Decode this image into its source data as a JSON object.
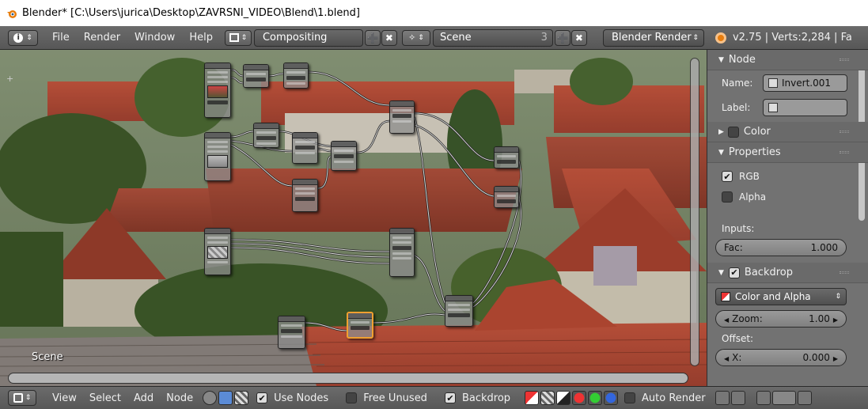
{
  "window": {
    "title": "Blender* [C:\\Users\\jurica\\Desktop\\ZAVRSNI_VIDEO\\Blend\\1.blend]"
  },
  "top_header": {
    "menus": [
      "File",
      "Render",
      "Window",
      "Help"
    ],
    "screen_layout": "Compositing",
    "scene": "Scene",
    "scene_users": "3",
    "render_engine": "Blender Render",
    "version_stats": "v2.75 | Verts:2,284 | Fa"
  },
  "editor": {
    "scene_label": "Scene",
    "plus": "+"
  },
  "properties_panel": {
    "node_section": {
      "header": "Node",
      "name_label": "Name:",
      "name_value": "Invert.001",
      "label_label": "Label:",
      "label_value": ""
    },
    "color_section": {
      "header": "Color"
    },
    "properties_section": {
      "header": "Properties",
      "rgb_label": "RGB",
      "rgb_checked": true,
      "alpha_label": "Alpha",
      "alpha_checked": false,
      "inputs_label": "Inputs:",
      "fac_label": "Fac:",
      "fac_value": "1.000"
    },
    "backdrop_section": {
      "header": "Backdrop",
      "channels": "Color and Alpha",
      "zoom_label": "Zoom:",
      "zoom_value": "1.00",
      "offset_label": "Offset:",
      "x_label": "X:",
      "x_value": "0.000"
    }
  },
  "bottom_header": {
    "menus": [
      "View",
      "Select",
      "Add",
      "Node"
    ],
    "use_nodes_label": "Use Nodes",
    "use_nodes_checked": true,
    "free_unused_label": "Free Unused",
    "free_unused_checked": false,
    "backdrop_label": "Backdrop",
    "backdrop_checked": true,
    "auto_render_label": "Auto Render",
    "auto_render_checked": false
  },
  "colors": {
    "header_bg": "#606060",
    "panel_bg": "#727272",
    "selected_node_outline": "#f0a030"
  }
}
